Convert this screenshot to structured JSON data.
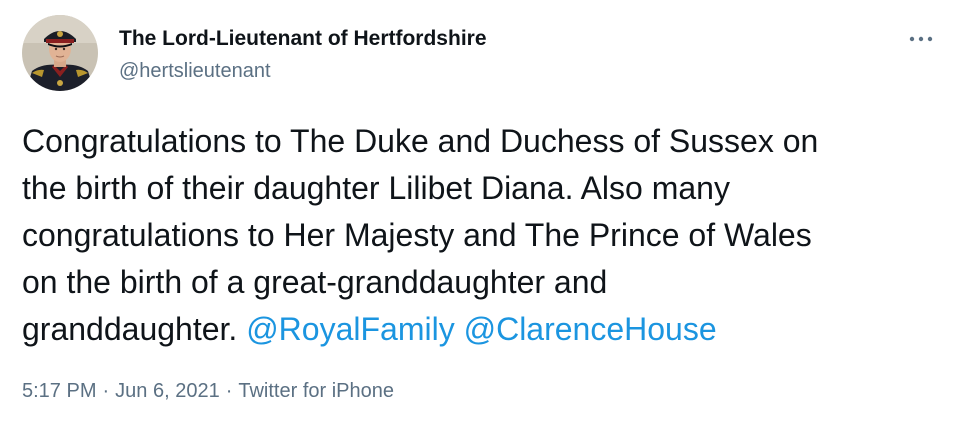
{
  "author": {
    "name": "The Lord-Lieutenant of Hertfordshire",
    "handle": "@hertslieutenant",
    "avatar_icon": "uniformed-man-portrait"
  },
  "menu": {
    "icon": "more-horizontal-icon"
  },
  "tweet": {
    "lines": [
      "Congratulations to The Duke and Duchess of Sussex on",
      "the birth of their daughter Lilibet Diana. Also many",
      "congratulations to Her Majesty and The Prince of Wales",
      "on the birth of a great-granddaughter and"
    ],
    "last_line_text": "granddaughter.",
    "mentions": [
      "@RoyalFamily",
      "@ClarenceHouse"
    ]
  },
  "meta": {
    "time": "5:17 PM",
    "separator": "·",
    "date": "Jun 6, 2021",
    "source": "Twitter for iPhone"
  },
  "colors": {
    "text": "#0f1419",
    "secondary": "#5b7083",
    "link": "#1b95e0"
  }
}
